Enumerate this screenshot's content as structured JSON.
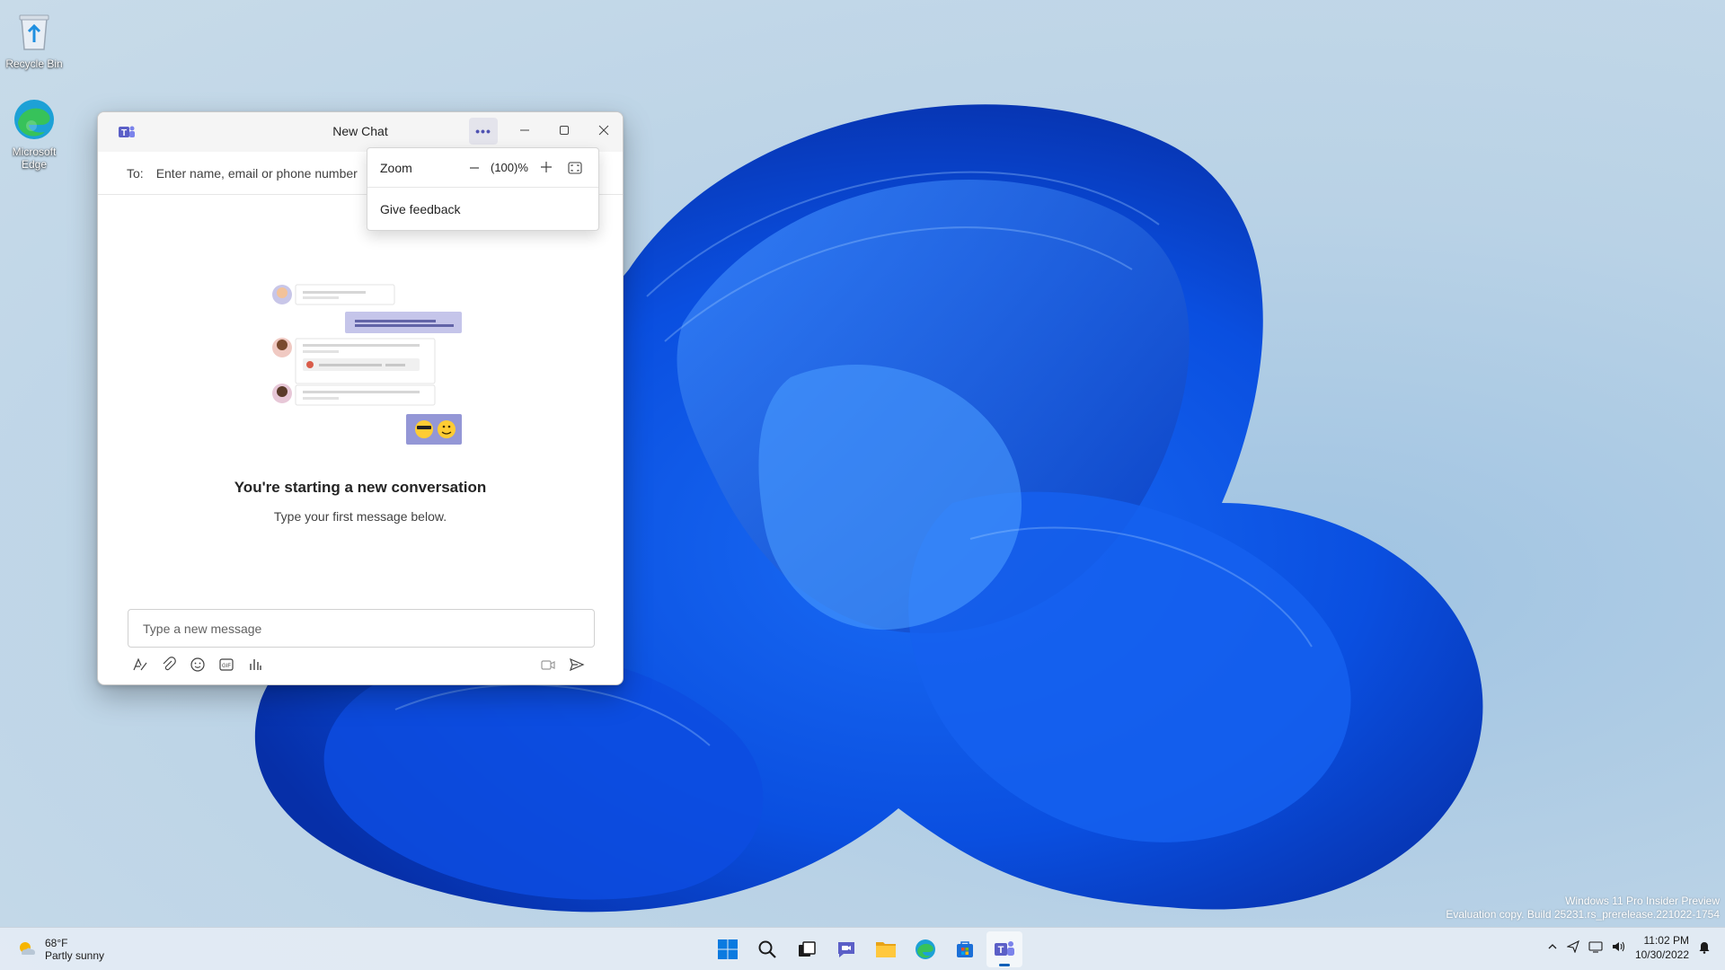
{
  "desktop": {
    "icons": [
      {
        "label": "Recycle Bin",
        "icon": "recycle-bin-icon"
      },
      {
        "label": "Microsoft Edge",
        "icon": "edge-icon"
      }
    ]
  },
  "window": {
    "title": "New Chat",
    "more_label": "•••",
    "to_label": "To:",
    "to_placeholder": "Enter name, email or phone number"
  },
  "menu": {
    "zoom_label": "Zoom",
    "zoom_value": "(100)%",
    "feedback_label": "Give feedback"
  },
  "conversation": {
    "heading": "You're starting a new conversation",
    "subheading": "Type your first message below."
  },
  "compose": {
    "placeholder": "Type a new message"
  },
  "taskbar": {
    "weather_temp": "68°F",
    "weather_desc": "Partly sunny",
    "apps": [
      "start-icon",
      "search-icon",
      "task-view-icon",
      "teams-chat-icon",
      "file-explorer-icon",
      "edge-icon",
      "store-icon",
      "teams-icon"
    ],
    "time": "11:02 PM",
    "date": "10/30/2022"
  },
  "watermark": {
    "line1": "Windows 11 Pro Insider Preview",
    "line2": "Evaluation copy. Build 25231.rs_prerelease.221022-1754"
  },
  "colors": {
    "teams_purple": "#5b5fc7",
    "windows_blue": "#005fb8",
    "bloom_blue": "#0a4fe0"
  }
}
